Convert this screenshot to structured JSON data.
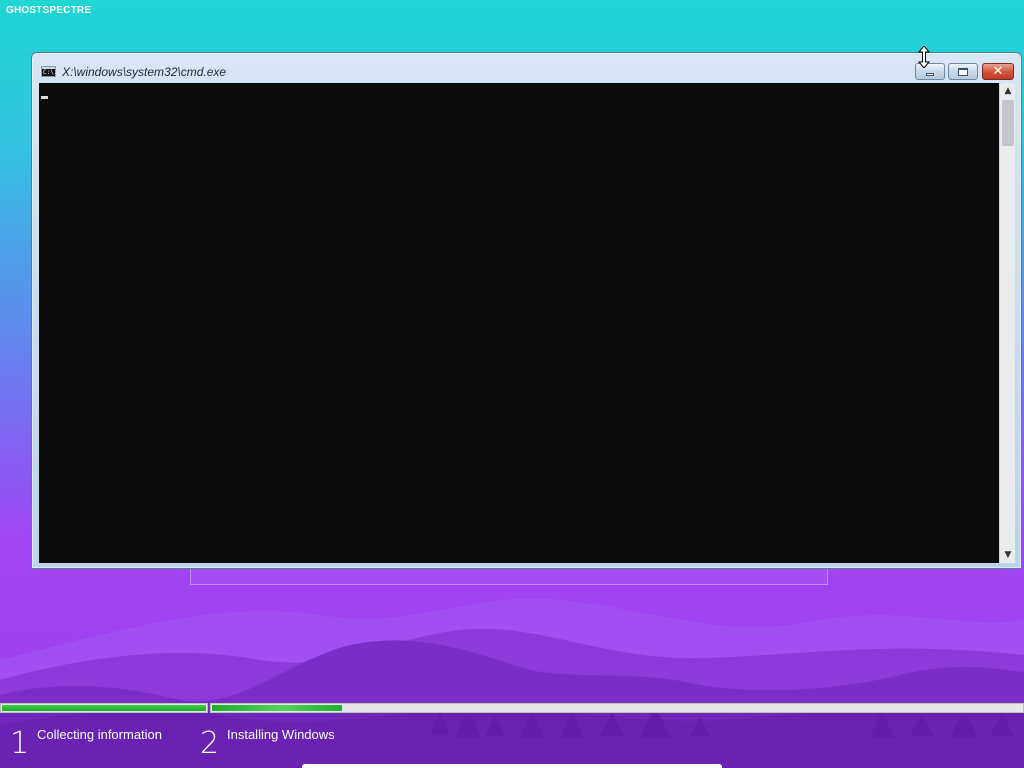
{
  "brand": {
    "label": "GHOSTSPECTRE"
  },
  "cmd_window": {
    "title": "X:\\windows\\system32\\cmd.exe",
    "app_icon": "cmd-icon",
    "icon_text": "C:\\.",
    "buttons": {
      "minimize_icon": "minimize-icon",
      "maximize_icon": "restore-icon",
      "close_icon": "close-icon",
      "close_glyph": "✕"
    },
    "scroll_up_glyph": "▲",
    "scroll_down_glyph": "▼"
  },
  "setup": {
    "progress": {
      "step1_fraction": 1.0,
      "step2_fraction": 0.16
    },
    "steps": [
      {
        "number": "1",
        "label": "Collecting information"
      },
      {
        "number": "2",
        "label": "Installing Windows"
      }
    ]
  },
  "colors": {
    "progress_green": "#1eae2c",
    "console_bg": "#0c0c0c",
    "close_red": "#c03a22"
  }
}
